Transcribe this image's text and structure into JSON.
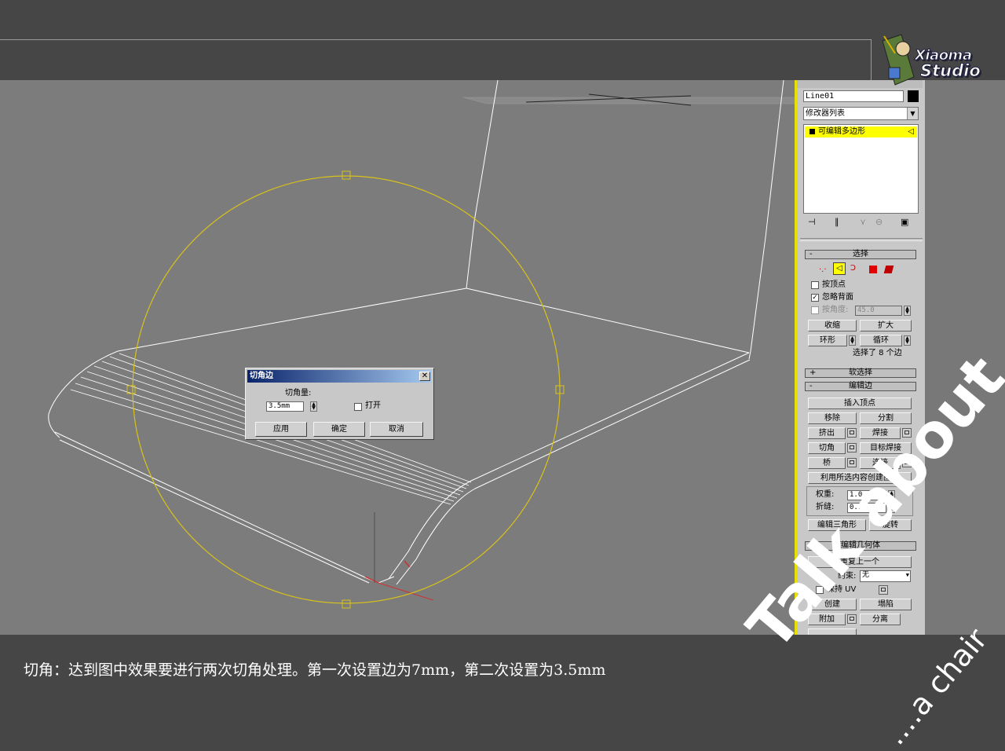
{
  "logo": {
    "line1": "Xiaoma",
    "line2": "Studio"
  },
  "command_panel": {
    "object_name": "Line01",
    "object_color": "#000000",
    "modifier_list": "修改器列表",
    "stack_item": "可编辑多边形",
    "selection": {
      "title": "选择",
      "by_vertex": "按顶点",
      "ignore_backfacing": "忽略背面",
      "by_angle": "按角度:",
      "angle_value": "45.0",
      "shrink": "收缩",
      "grow": "扩大",
      "ring": "环形",
      "loop": "循环",
      "status": "选择了 8 个边"
    },
    "soft_selection": {
      "title": "软选择"
    },
    "edit_edges": {
      "title": "编辑边",
      "insert_vertex": "插入顶点",
      "remove": "移除",
      "split": "分割",
      "extrude": "挤出",
      "weld": "焊接",
      "chamfer": "切角",
      "target_weld": "目标焊接",
      "bridge": "桥",
      "connect": "连接",
      "create_shape": "利用所选内容创建图形",
      "weight_label": "权重:",
      "weight_value": "1.0",
      "crease_label": "折缝:",
      "crease_value": "0.0",
      "edit_tri": "编辑三角形",
      "turn": "旋转"
    },
    "edit_geometry": {
      "title": "编辑几何体",
      "repeat_last": "重复上一个",
      "constraint_label": "约束:",
      "constraint_value": "无",
      "preserve_uv": "保持 UV",
      "create": "创建",
      "collapse": "塌陷",
      "attach": "附加",
      "detach": "分离"
    }
  },
  "dialog": {
    "title": "切角边",
    "amount_label": "切角量:",
    "amount_value": "3.5mm",
    "open_label": "打开",
    "apply": "应用",
    "ok": "确定",
    "cancel": "取消"
  },
  "caption": "切角：达到图中效果要进行两次切角处理。第一次设置边为7mm，第二次设置为3.5mm",
  "watermark": {
    "line1": "Talk about",
    "line2": "....a chair"
  },
  "colors": {
    "gizmo": "#d8c21a",
    "wire": "#ffffff",
    "viewport_bg": "#7c7c7c",
    "highlight": "#ffff00"
  }
}
